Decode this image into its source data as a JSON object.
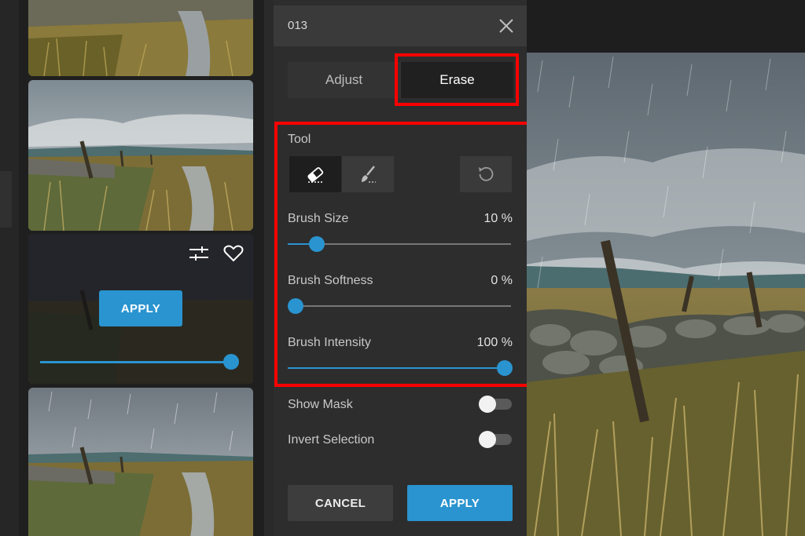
{
  "panel": {
    "title": "013",
    "tabs": [
      {
        "label": "Adjust",
        "active": false
      },
      {
        "label": "Erase",
        "active": true
      }
    ],
    "tool_label": "Tool",
    "tools": [
      "eraser-icon",
      "brush-icon",
      "reset-icon"
    ],
    "brush_size": {
      "label": "Brush Size",
      "value_text": "10 %",
      "value": 10
    },
    "brush_softness": {
      "label": "Brush Softness",
      "value_text": "0 %",
      "value": 0
    },
    "brush_intensity": {
      "label": "Brush Intensity",
      "value_text": "100 %",
      "value": 100
    },
    "show_mask": {
      "label": "Show Mask",
      "on": false
    },
    "invert_selection": {
      "label": "Invert Selection",
      "on": false
    },
    "cancel_label": "CANCEL",
    "apply_label": "APPLY"
  },
  "filmstrip": {
    "active_thumb": {
      "apply_label": "APPLY",
      "strength": 100
    },
    "icons": [
      "sliders-icon",
      "heart-icon"
    ]
  },
  "colors": {
    "accent": "#2a94d0",
    "highlight": "#ff0000",
    "panel_bg": "#2d2d2d"
  }
}
